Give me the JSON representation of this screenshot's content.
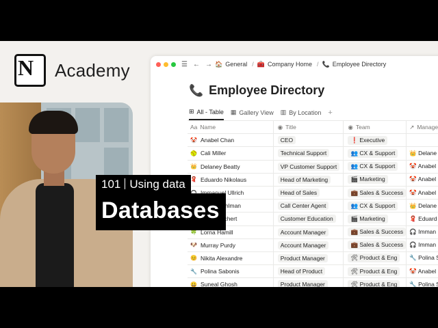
{
  "brand": {
    "logo_letter": "N",
    "name": "Academy"
  },
  "overlay": {
    "number": "101",
    "subtitle": "Using data",
    "headline": "Databases"
  },
  "window": {
    "traffic_colors": [
      "#ff5f57",
      "#febc2e",
      "#28c840"
    ],
    "breadcrumbs": [
      {
        "icon": "🏠",
        "label": "General"
      },
      {
        "icon": "🧰",
        "label": "Company Home"
      },
      {
        "icon": "📞",
        "label": "Employee Directory"
      }
    ],
    "title": "Employee Directory",
    "title_icon": "📞",
    "views": [
      {
        "icon": "⊞",
        "label": "All - Table",
        "active": true
      },
      {
        "icon": "▦",
        "label": "Gallery View",
        "active": false
      },
      {
        "icon": "▥",
        "label": "By Location",
        "active": false
      }
    ],
    "add_view": "+",
    "columns": [
      {
        "icon": "Aa",
        "label": "Name"
      },
      {
        "icon": "◉",
        "label": "Title"
      },
      {
        "icon": "◉",
        "label": "Team"
      },
      {
        "icon": "↗",
        "label": "Manage"
      }
    ],
    "rows": [
      {
        "emoji": "🤡",
        "name": "Anabel Chan",
        "title": "CEO",
        "team": "❗ Executive",
        "manager": ""
      },
      {
        "emoji": "🥎",
        "name": "Cali Miller",
        "title": "Technical Support",
        "team": "👥 CX & Support",
        "manager": "👑 Delane"
      },
      {
        "emoji": "👑",
        "name": "Delaney Beatty",
        "title": "VP Customer Support",
        "team": "👥 CX & Support",
        "manager": "🤡 Anabel"
      },
      {
        "emoji": "🧣",
        "name": "Eduardo Nikolaus",
        "title": "Head of Marketing",
        "team": "🎬 Marketing",
        "manager": "🤡 Anabel"
      },
      {
        "emoji": "🎧",
        "name": "Immanuel Ullrich",
        "title": "Head of Sales",
        "team": "💼 Sales & Success",
        "manager": "🤡 Anabel"
      },
      {
        "emoji": "🐼",
        "name": "Jaden Kuhlman",
        "title": "Call Center Agent",
        "team": "👥 CX & Support",
        "manager": "👑 Delane"
      },
      {
        "emoji": "🌸",
        "name": "Kaya Reichert",
        "title": "Customer Education",
        "team": "🎬 Marketing",
        "manager": "🧣 Eduard"
      },
      {
        "emoji": "🍀",
        "name": "Lorna Hamill",
        "title": "Account Manager",
        "team": "💼 Sales & Success",
        "manager": "🎧 Imman"
      },
      {
        "emoji": "🐶",
        "name": "Murray Purdy",
        "title": "Account Manager",
        "team": "💼 Sales & Success",
        "manager": "🎧 Imman"
      },
      {
        "emoji": "😊",
        "name": "Nikita Alexandre",
        "title": "Product Manager",
        "team": "🛠 Product & Eng",
        "manager": "🔧 Polina S"
      },
      {
        "emoji": "🔧",
        "name": "Polina Sabonis",
        "title": "Head of Product",
        "team": "🛠 Product & Eng",
        "manager": "🤡 Anabel"
      },
      {
        "emoji": "😀",
        "name": "Suneal Ghosh",
        "title": "Product Manager",
        "team": "🛠 Product & Eng",
        "manager": "🔧 Polina S"
      }
    ]
  }
}
